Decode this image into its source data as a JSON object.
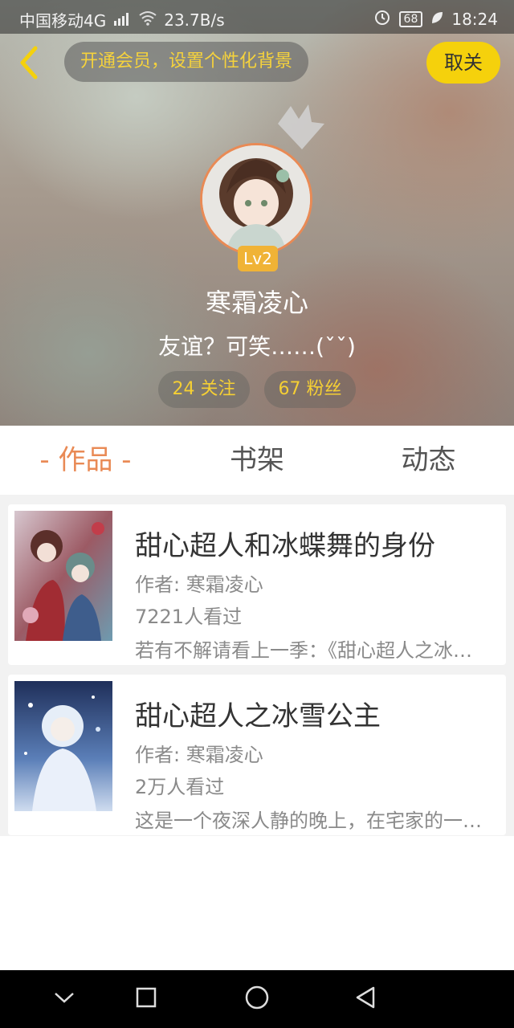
{
  "status_bar": {
    "carrier": "中国移动4G",
    "network_badge": "4G",
    "speed": "23.7B/s",
    "battery": "68",
    "time": "18:24"
  },
  "header": {
    "vip_banner": "开通会员，设置个性化背景",
    "cancel_label": "取关",
    "level": "Lv2",
    "username": "寒霜凌心",
    "signature": "友谊？可笑……(ˇˇ)",
    "following": "24 关注",
    "followers": "67 粉丝"
  },
  "tabs": [
    {
      "label": "- 作品 -",
      "active": true
    },
    {
      "label": "书架",
      "active": false
    },
    {
      "label": "动态",
      "active": false
    }
  ],
  "books": [
    {
      "title": "甜心超人和冰蝶舞的身份",
      "author": "作者: 寒霜凌心",
      "views": "7221人看过",
      "desc": "若有不解请看上一季：《甜心超人之冰雪公主》"
    },
    {
      "title": "甜心超人之冰雪公主",
      "author": "作者: 寒霜凌心",
      "views": "2万人看过",
      "desc": "这是一个夜深人静的晚上，在宅家的一个房间里"
    }
  ],
  "icons": {
    "back": "chevron-left-icon",
    "crown": "crown-icon",
    "nav_back": "triangle-back-icon",
    "nav_home": "circle-home-icon",
    "nav_recent": "square-recent-icon",
    "nav_hide": "chevron-down-icon"
  },
  "colors": {
    "accent_orange": "#e98a55",
    "accent_yellow": "#f5d10c",
    "level_badge": "#f0b336"
  }
}
